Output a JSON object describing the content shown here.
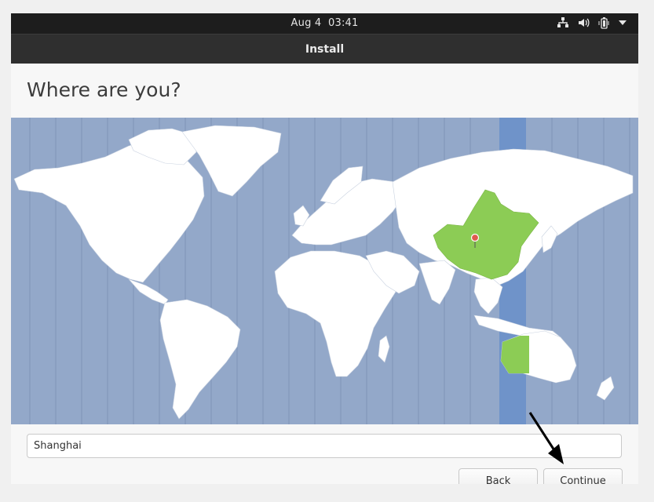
{
  "topbar": {
    "date": "Aug 4",
    "time": "03:41",
    "icons": [
      "network-icon",
      "volume-icon",
      "battery-icon",
      "system-menu-arrow-icon"
    ]
  },
  "window": {
    "title": "Install"
  },
  "page": {
    "heading": "Where are you?"
  },
  "map": {
    "selected_city": "Shanghai",
    "colors": {
      "ocean": "#93a8c9",
      "land": "#ffffff",
      "highlight_zone": "#6f93c9",
      "selected_region": "#8ccc55",
      "pin": "#e05a4e"
    }
  },
  "location": {
    "value": "Shanghai"
  },
  "buttons": {
    "back_label": "Back",
    "continue_label": "Continue"
  }
}
